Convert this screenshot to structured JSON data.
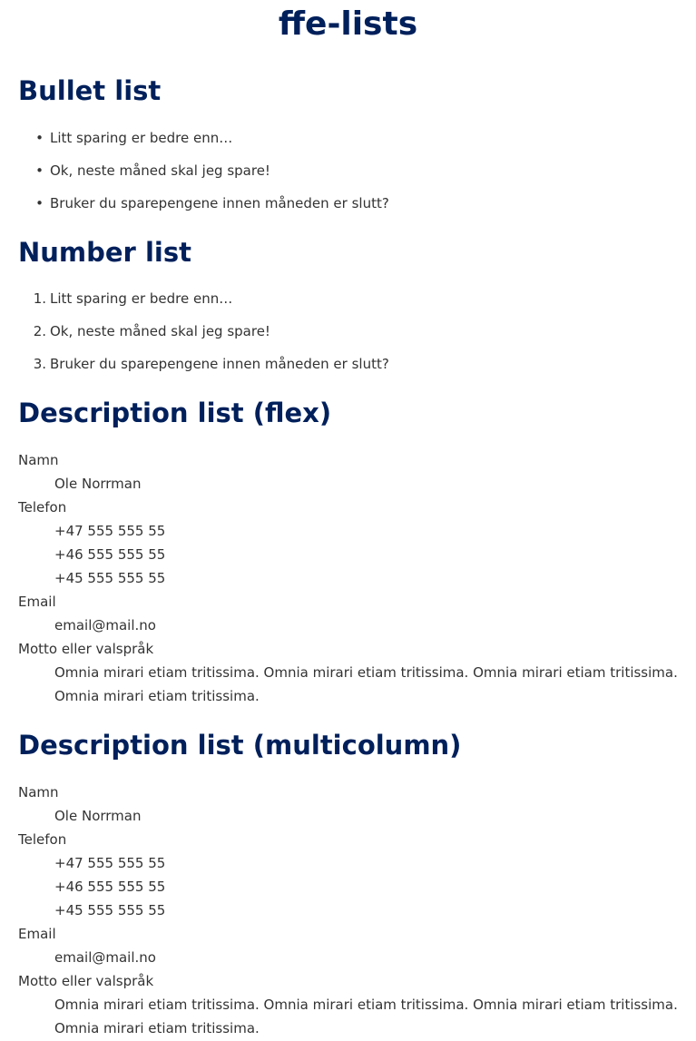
{
  "title": "ffe-lists",
  "bullet": {
    "heading": "Bullet list",
    "items": [
      "Litt sparing er bedre enn…",
      "Ok, neste måned skal jeg spare!",
      "Bruker du sparepengene innen måneden er slutt?"
    ]
  },
  "number": {
    "heading": "Number list",
    "items": [
      "Litt sparing er bedre enn…",
      "Ok, neste måned skal jeg spare!",
      "Bruker du sparepengene innen måneden er slutt?"
    ]
  },
  "desc_flex": {
    "heading": "Description list (flex)",
    "name_term": "Namn",
    "name_value": "Ole Norrman",
    "phone_term": "Telefon",
    "phones": [
      "+47 555 555 55",
      "+46 555 555 55",
      "+45 555 555 55"
    ],
    "email_term": "Email",
    "email_value": "email@mail.no",
    "motto_term": "Motto eller valspråk",
    "motto_value": "Omnia mirari etiam tritissima. Omnia mirari etiam tritissima. Omnia mirari etiam tritissima. Omnia mirari etiam tritissima."
  },
  "desc_multi": {
    "heading": "Description list (multicolumn)",
    "name_term": "Namn",
    "name_value": "Ole Norrman",
    "phone_term": "Telefon",
    "phones": [
      "+47 555 555 55",
      "+46 555 555 55",
      "+45 555 555 55"
    ],
    "email_term": "Email",
    "email_value": "email@mail.no",
    "motto_term": "Motto eller valspråk",
    "motto_value": "Omnia mirari etiam tritissima. Omnia mirari etiam tritissima. Omnia mirari etiam tritissima. Omnia mirari etiam tritissima."
  },
  "colors": {
    "heading": "#00205b",
    "text": "#333333"
  }
}
